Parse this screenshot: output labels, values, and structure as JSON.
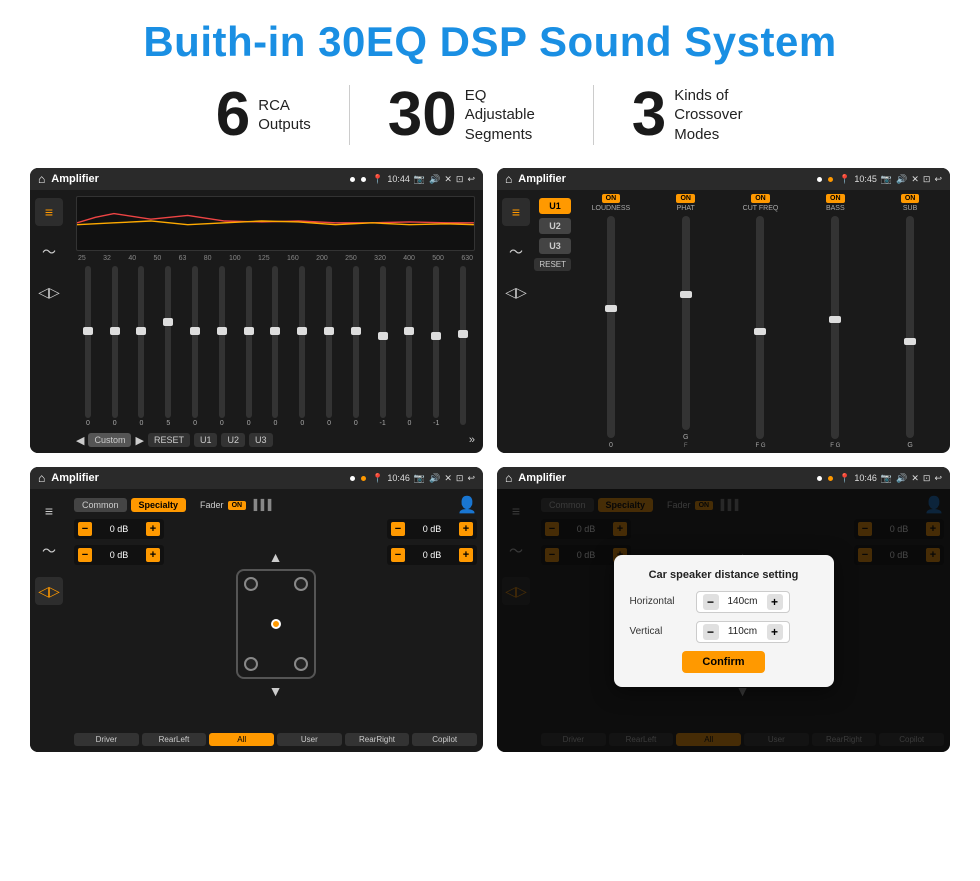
{
  "page": {
    "title": "Buith-in 30EQ DSP Sound System"
  },
  "stats": [
    {
      "number": "6",
      "label_line1": "RCA",
      "label_line2": "Outputs"
    },
    {
      "number": "30",
      "label_line1": "EQ Adjustable",
      "label_line2": "Segments"
    },
    {
      "number": "3",
      "label_line1": "Kinds of",
      "label_line2": "Crossover Modes"
    }
  ],
  "screens": {
    "eq": {
      "title": "Amplifier",
      "time": "10:44",
      "freq_labels": [
        "25",
        "32",
        "40",
        "50",
        "63",
        "80",
        "100",
        "125",
        "160",
        "200",
        "250",
        "320",
        "400",
        "500",
        "630"
      ],
      "values": [
        "0",
        "0",
        "0",
        "5",
        "0",
        "0",
        "0",
        "0",
        "0",
        "0",
        "0",
        "-1",
        "0",
        "-1"
      ],
      "controls": [
        "Custom",
        "RESET",
        "U1",
        "U2",
        "U3"
      ]
    },
    "crossover": {
      "title": "Amplifier",
      "time": "10:45",
      "presets": [
        "U1",
        "U2",
        "U3"
      ],
      "channels": [
        "LOUDNESS",
        "PHAT",
        "CUT FREQ",
        "BASS",
        "SUB"
      ],
      "on_labels": [
        "ON",
        "ON",
        "ON",
        "ON",
        "ON"
      ],
      "reset_label": "RESET"
    },
    "fader": {
      "title": "Amplifier",
      "time": "10:46",
      "tabs": [
        "Common",
        "Specialty"
      ],
      "fader_label": "Fader",
      "on_label": "ON",
      "volumes": [
        "0 dB",
        "0 dB",
        "0 dB",
        "0 dB"
      ],
      "buttons": [
        "Driver",
        "RearLeft",
        "All",
        "User",
        "RearRight",
        "Copilot"
      ]
    },
    "dialog": {
      "title": "Amplifier",
      "time": "10:46",
      "tabs": [
        "Common",
        "Specialty"
      ],
      "on_label": "ON",
      "dialog_title": "Car speaker distance setting",
      "horizontal_label": "Horizontal",
      "horizontal_value": "140cm",
      "vertical_label": "Vertical",
      "vertical_value": "110cm",
      "confirm_label": "Confirm",
      "right_volumes": [
        "0 dB",
        "0 dB"
      ],
      "buttons": [
        "Driver",
        "RearLeft",
        "All",
        "User",
        "RearRight",
        "Copilot"
      ]
    }
  }
}
